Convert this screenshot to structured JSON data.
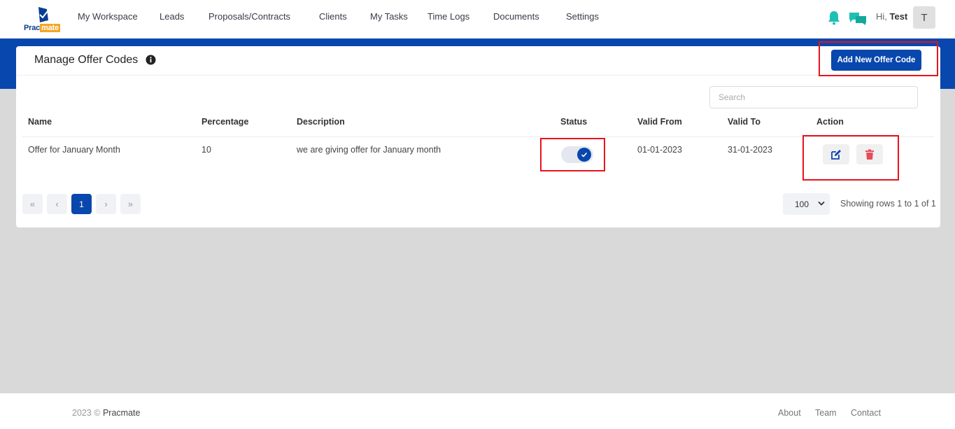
{
  "brand": {
    "logo_text_a": "Prac",
    "logo_text_b": "mate",
    "accent": "#0847ad",
    "highlight": "#f5a623"
  },
  "nav": {
    "items": [
      "My Workspace",
      "Leads",
      "Proposals/Contracts",
      "Clients",
      "My Tasks",
      "Time Logs",
      "Documents",
      "Settings"
    ],
    "greeting_prefix": "Hi, ",
    "user_name": "Test",
    "avatar_letter": "T",
    "icons": [
      "bell-icon",
      "chat-icon"
    ]
  },
  "page": {
    "title": "Manage Offer Codes",
    "add_button": "Add New Offer Code",
    "search_placeholder": "Search"
  },
  "table": {
    "headers": [
      "Name",
      "Percentage",
      "Description",
      "Status",
      "Valid From",
      "Valid To",
      "Action"
    ],
    "rows": [
      {
        "name": "Offer for January Month",
        "percentage": "10",
        "description": "we are giving offer for January month",
        "status_on": true,
        "valid_from": "01-01-2023",
        "valid_to": "31-01-2023"
      }
    ]
  },
  "pagination": {
    "first": "«",
    "prev": "‹",
    "current": "1",
    "next": "›",
    "last": "»",
    "rows_per_page": "100",
    "showing": "Showing rows 1 to  1 of 1"
  },
  "footer": {
    "year": "2023 © ",
    "brand": "Pracmate",
    "links": [
      "About",
      "Team",
      "Contact"
    ]
  },
  "colors": {
    "status_on": "#0847ad",
    "edit": "#0847ad",
    "delete": "#e74c5a",
    "annotation": "#e8121c"
  }
}
